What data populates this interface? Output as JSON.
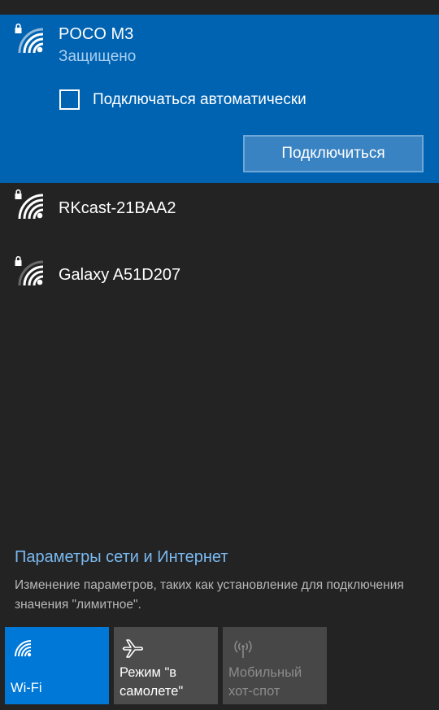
{
  "networks": {
    "selected": {
      "name": "POCO M3",
      "status": "Защищено",
      "auto_connect_label": "Подключаться автоматически",
      "auto_connect_checked": false,
      "connect_button": "Подключиться",
      "icon": "wifi-secured-icon"
    },
    "others": [
      {
        "name": "RKcast-21BAA2",
        "icon": "wifi-secured-icon"
      },
      {
        "name": "Galaxy A51D207",
        "icon": "wifi-secured-icon"
      }
    ]
  },
  "footer": {
    "settings_link": "Параметры сети и Интернет",
    "settings_description": "Изменение параметров, таких как установление для подключения значения \"лимитное\"."
  },
  "quick_actions": [
    {
      "label": "Wi-Fi",
      "icon": "wifi-icon",
      "state": "on",
      "color": "#0078d7"
    },
    {
      "label": "Режим \"в самолете\"",
      "icon": "airplane-icon",
      "state": "off",
      "color": "#4c4c4c"
    },
    {
      "label": "Мобильный хот-спот",
      "icon": "hotspot-icon",
      "state": "disabled",
      "color": "#474747"
    }
  ],
  "colors": {
    "background": "#232323",
    "accent": "#0063b1",
    "link": "#7ab9f0"
  }
}
